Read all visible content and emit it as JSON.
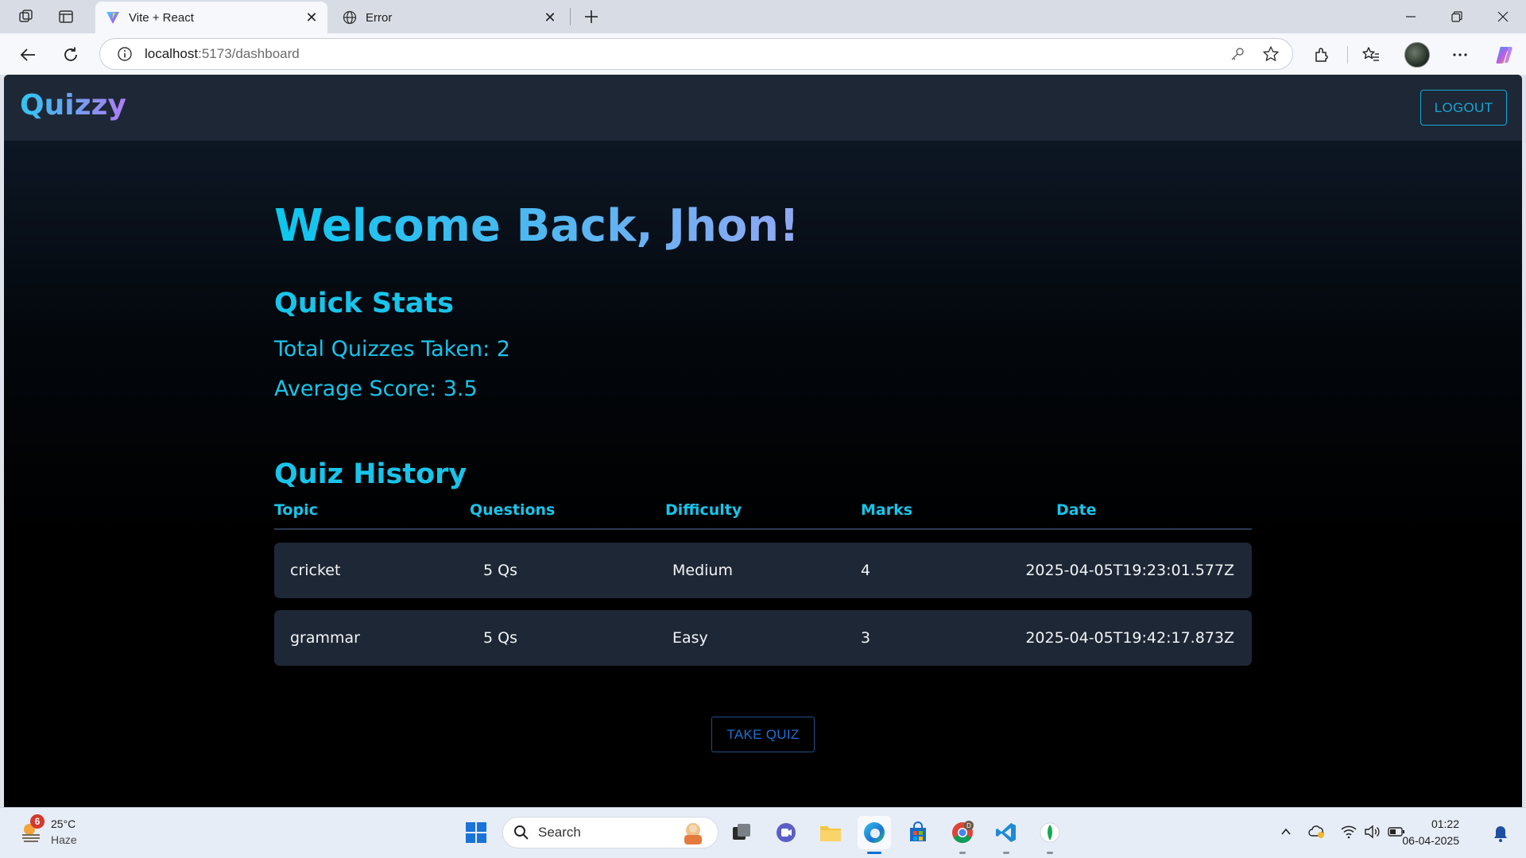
{
  "browser": {
    "tabs": [
      {
        "title": "Vite + React",
        "active": true
      },
      {
        "title": "Error",
        "active": false
      }
    ],
    "url_host": "localhost",
    "url_path": ":5173/dashboard"
  },
  "app": {
    "brand": "Quizzy",
    "logout_label": "LOGOUT",
    "welcome": "Welcome Back, Jhon!",
    "quick_stats": {
      "heading": "Quick Stats",
      "total_quizzes": "Total Quizzes Taken: 2",
      "average_score": "Average Score: 3.5"
    },
    "history": {
      "heading": "Quiz History",
      "columns": [
        "Topic",
        "Questions",
        "Difficulty",
        "Marks",
        "Date"
      ],
      "rows": [
        {
          "topic": "cricket",
          "questions": "5 Qs",
          "difficulty": "Medium",
          "marks": "4",
          "date": "2025-04-05T19:23:01.577Z"
        },
        {
          "topic": "grammar",
          "questions": "5 Qs",
          "difficulty": "Easy",
          "marks": "3",
          "date": "2025-04-05T19:42:17.873Z"
        }
      ]
    },
    "take_quiz_label": "TAKE QUIZ"
  },
  "taskbar": {
    "weather_badge": "6",
    "temperature": "25°C",
    "condition": "Haze",
    "search_placeholder": "Search",
    "time": "01:22",
    "date": "06-04-2025",
    "chrome_badge": "D"
  },
  "colors": {
    "accent_cyan": "#18c4ea",
    "appbar_bg": "#1e2735",
    "row_bg": "#1e2735",
    "take_quiz_text": "#1d6fd6"
  }
}
